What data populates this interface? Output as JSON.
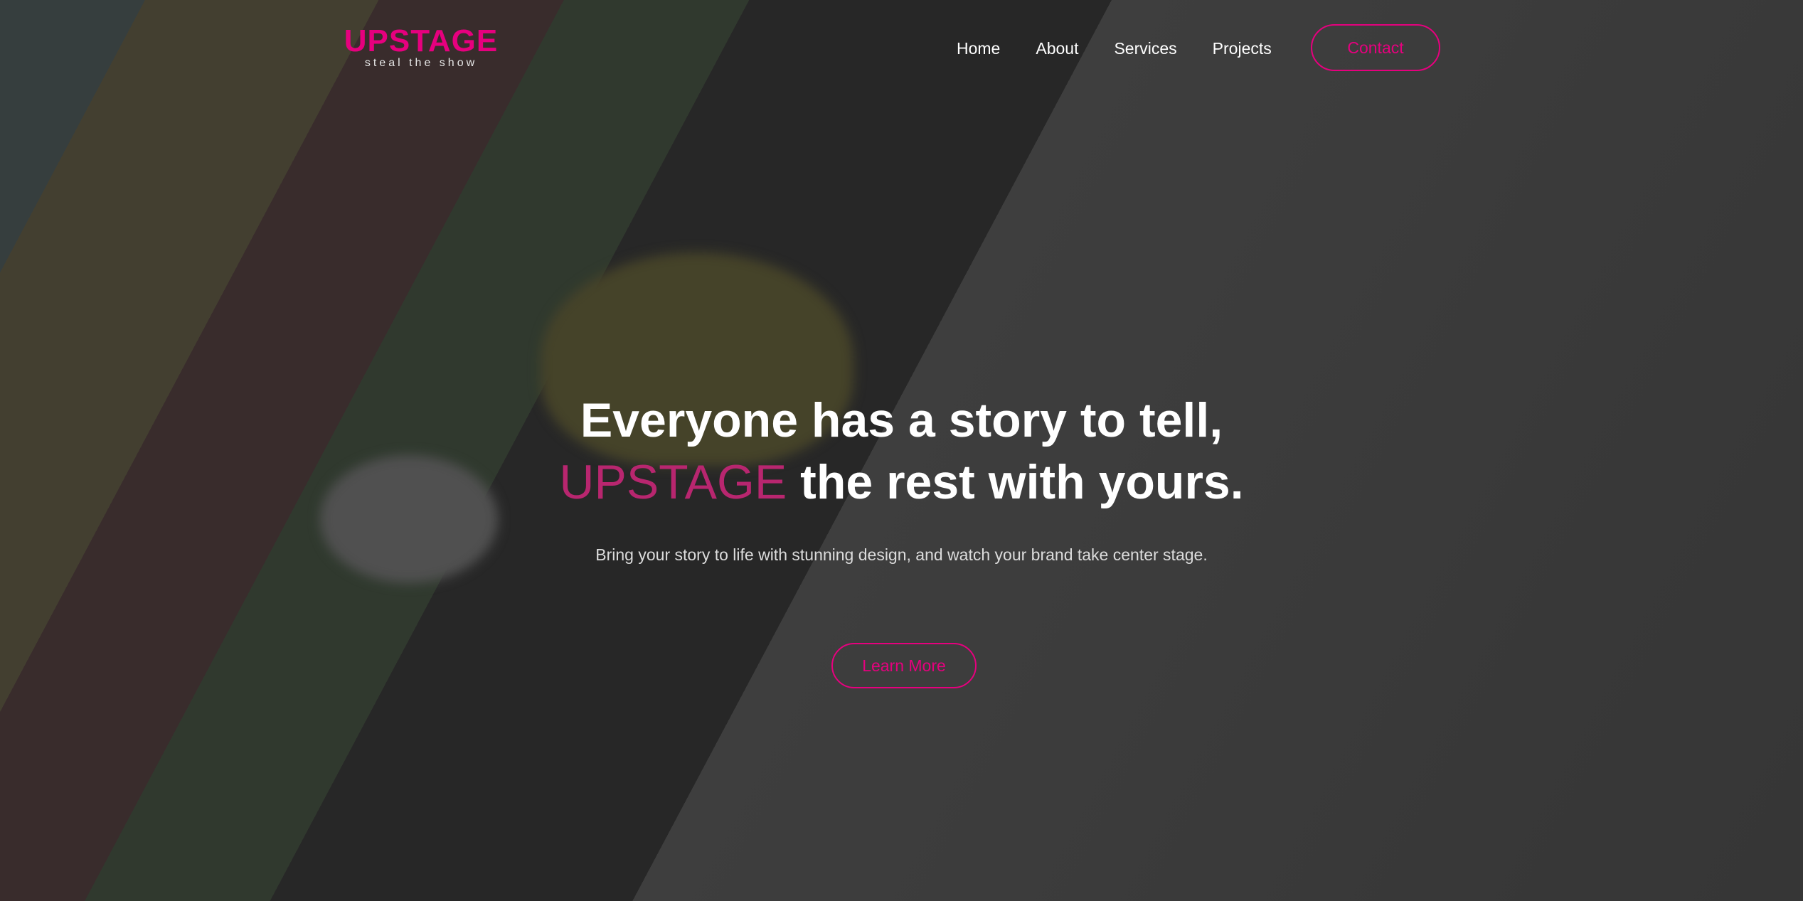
{
  "brand": {
    "logo": "UPSTAGE",
    "tagline": "steal the show",
    "accent": "#e6007e"
  },
  "nav": {
    "items": [
      "Home",
      "About",
      "Services",
      "Projects"
    ],
    "contact_label": "Contact"
  },
  "hero": {
    "line1": "Everyone has a story to tell,",
    "line2_brand": "UPSTAGE",
    "line2_rest": " the rest with yours.",
    "subtitle": "Bring your story to life with stunning design, and watch your brand take center stage.",
    "cta_label": "Learn More"
  }
}
